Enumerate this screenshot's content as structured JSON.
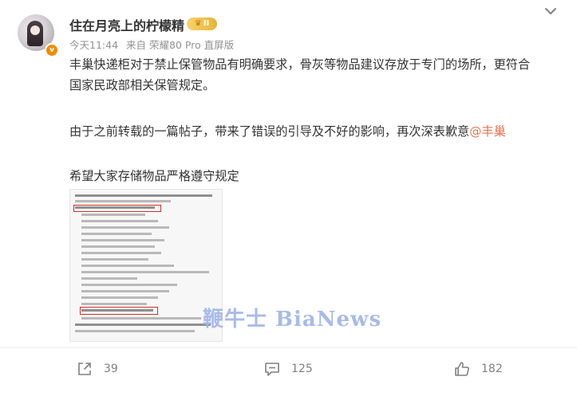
{
  "author": {
    "name": "住在月亮上的柠檬精",
    "level_badge": "II",
    "verified_icon": "v-verified-icon",
    "avatar_icon": "user-avatar"
  },
  "meta": {
    "time": "今天11:44",
    "source": "来自 荣耀80 Pro 直屏版"
  },
  "content": {
    "paragraph1_line1": "丰巢快递柜对于禁止保管物品有明确要求，骨灰等物品建议存放于专门的场所，更符合",
    "paragraph1_line2": "国家民政部相关保管规定。",
    "paragraph2_text": "由于之前转载的一篇帖子，带来了错误的引导及不好的影响，再次深表歉意",
    "paragraph2_mention": "@丰巢",
    "paragraph3": "希望大家存储物品严格遵守规定"
  },
  "image": {
    "description_icon": "document-screenshot-image"
  },
  "watermark": {
    "text": "鞭牛士 BiaNews"
  },
  "actions": {
    "share_count": "39",
    "comment_count": "125",
    "like_count": "182"
  },
  "colors": {
    "mention": "#eb7350",
    "meta": "#939393",
    "icon": "#808080",
    "verified": "#f08c00"
  }
}
